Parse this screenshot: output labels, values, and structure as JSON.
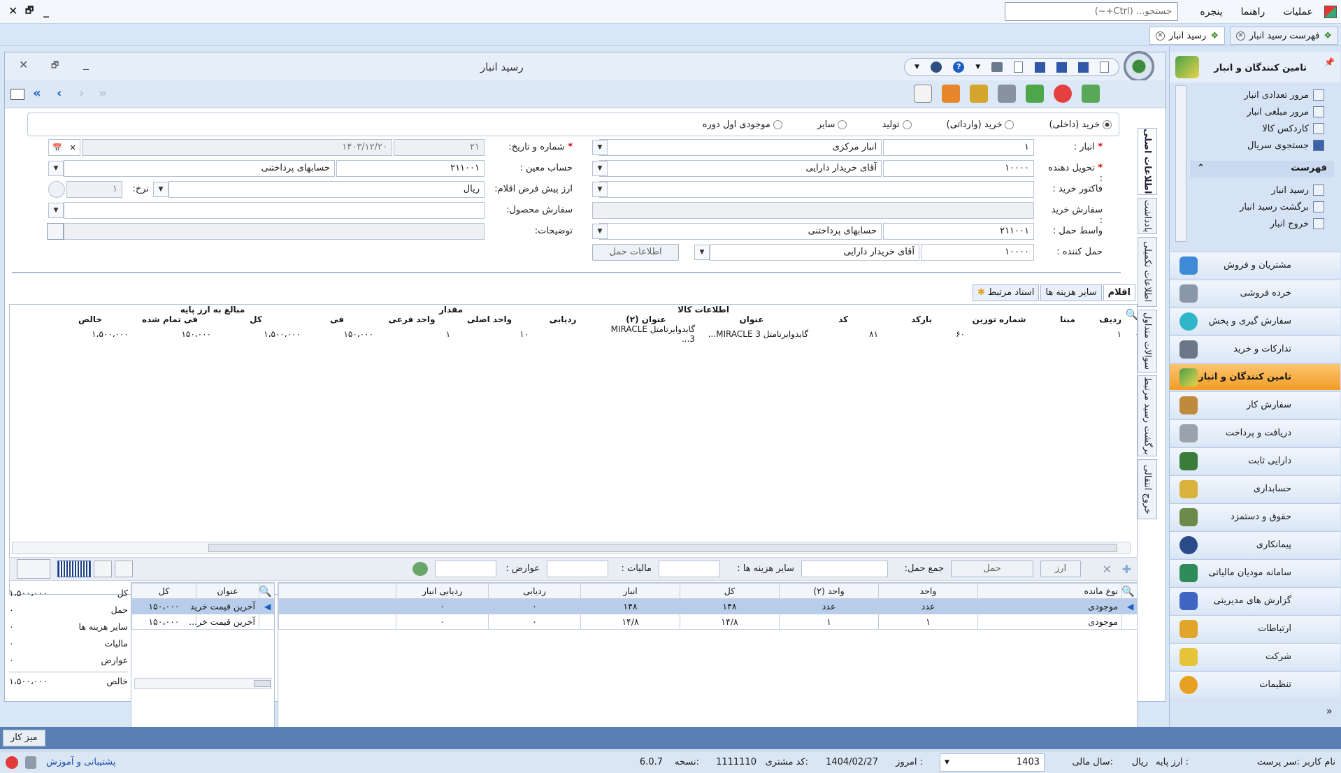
{
  "menu": {
    "items": [
      "عملیات",
      "راهنما",
      "پنجره"
    ],
    "search_placeholder": "جستجو... (Ctrl+~)"
  },
  "tabs": [
    {
      "label": "فهرست رسید انبار"
    },
    {
      "label": "رسید انبار"
    }
  ],
  "window": {
    "title": "رسید انبار"
  },
  "vtabs": [
    "اطلاعات اصلی",
    "یادداشت",
    "اطلاعات تکمیلی",
    "سوالات متداول",
    "برگشت رسید مرتبط",
    "خروج انتقالی"
  ],
  "form": {
    "radios": [
      "خرید (داخلی)",
      "خرید (وارداتی)",
      "تولید",
      "سایر",
      "موجودی اول دوره"
    ],
    "anbar_label": "انبار :",
    "anbar_code": "۱",
    "anbar_name": "انبار مرکزی",
    "tahvil_label": "تحویل دهنده :",
    "tahvil_code": "۱۰۰۰۰",
    "tahvil_name": "آقای خریدار دارایی",
    "factor_label": "فاکتور خرید :",
    "sefaresh_label": "سفارش خرید :",
    "vaset_label": "واسط حمل :",
    "vaset_code": "۲۱۱۰۰۱",
    "vaset_name": "حسابهای پرداختنی",
    "haml_label": "حمل کننده :",
    "haml_code": "۱۰۰۰۰",
    "haml_name": "آقای خریدار دارایی",
    "haml_btn": "اطلاعات حمل",
    "shomare_label": "شماره و تاریخ:",
    "shomare": "۲۱",
    "tarikh": "۱۴۰۳/۱۲/۲۰",
    "hesab_label": "حساب معین :",
    "hesab_code": "۲۱۱۰۰۱",
    "hesab_name": "حسابهای پرداختنی",
    "arz_label": "ارز پیش فرض اقلام:",
    "arz": "ریال",
    "nerkh_label": "نرخ:",
    "nerkh": "۱",
    "mahsool_label": "سفارش محصول:",
    "tozih_label": "توضیحات:"
  },
  "gridtabs": [
    "اقلام",
    "سایر هزینه ها",
    "اسناد مرتبط"
  ],
  "grid": {
    "groups": [
      "اطلاعات کالا",
      "مقدار",
      "مبالغ به ارز پایه"
    ],
    "headers": [
      "ردیف",
      "مبنا",
      "شماره توزین",
      "بارکد",
      "کد",
      "عنوان",
      "عنوان (۲)",
      "ردیابی",
      "واحد اصلی",
      "واحد فرعی",
      "فی",
      "کل",
      "فی تمام شده",
      "خالص"
    ],
    "rows": [
      [
        "۱",
        "",
        "",
        "۶۰",
        "۸۱",
        "گایدوایرتامتل MIRACLE 3...",
        "گایدوایرتامتل MIRACLE 3...",
        "",
        "۱۰",
        "۱",
        "۱۵۰،۰۰۰",
        "۱،۵۰۰،۰۰۰",
        "۱۵۰،۰۰۰",
        "۱،۵۰۰،۰۰۰"
      ]
    ]
  },
  "bar2": {
    "arz": "ارز",
    "haml": "حمل",
    "jam_haml": "جمع حمل:",
    "sayer": "سایر هزینه ها :",
    "maliat": "مالیات :",
    "avarez": "عوارض :"
  },
  "bottom_left": {
    "headers": [
      "نوع مانده",
      "واحد",
      "واحد (۲)",
      "کل",
      "انبار",
      "ردیابی",
      "ردیابی انبار"
    ],
    "rows": [
      [
        "موجودی",
        "عدد",
        "عدد",
        "۱۴۸",
        "۱۴۸",
        "۰",
        "۰"
      ],
      [
        "موجودی",
        "۱",
        "۱",
        "۱۴/۸",
        "۱۴/۸",
        "۰",
        "۰"
      ]
    ]
  },
  "bottom_mid": {
    "headers": [
      "عنوان",
      "کل"
    ],
    "rows": [
      [
        "آخرین قیمت خرید",
        "۱۵۰،۰۰۰"
      ],
      [
        "آخرین قیمت خر...",
        "۱۵۰،۰۰۰"
      ]
    ]
  },
  "summary": [
    [
      "کل",
      "۱،۵۰۰،۰۰۰"
    ],
    [
      "حمل",
      "۰"
    ],
    [
      "سایر هزینه ها",
      "۰"
    ],
    [
      "مالیات",
      "۰"
    ],
    [
      "عوارض",
      "۰"
    ],
    [
      "خالص",
      "۱،۵۰۰،۰۰۰"
    ]
  ],
  "sidebar": {
    "title": "تامین کنندگان و انبار",
    "subitems": [
      "مرور تعدادی انبار",
      "مرور مبلغی انبار",
      "کاردکس کالا",
      "جستجوی سریال"
    ],
    "cat": "فهرست",
    "catitems": [
      "رسید انبار",
      "برگشت رسید انبار",
      "خروج انبار"
    ],
    "modules": [
      "مشتریان و فروش",
      "خرده فروشی",
      "سفارش گیری و پخش",
      "تدارکات و خرید",
      "تامین کنندگان و انبار",
      "سفارش کار",
      "دریافت و پرداخت",
      "دارایی ثابت",
      "حسابداری",
      "حقوق و دستمزد",
      "پیمانکاری",
      "سامانه مودیان مالیاتی",
      "گزارش های مدیریتی",
      "ارتباطات",
      "شرکت",
      "تنظیمات"
    ]
  },
  "taskbar": {
    "label": "میز کار"
  },
  "status": {
    "user": "نام کاربر :سر پرست",
    "arz": "ارز پایه :",
    "arz_v": "ریال",
    "year": "سال مالی:",
    "year_v": "1403",
    "today": "امروز :",
    "today_v": "1404/02/27",
    "cust": "کد مشتری:",
    "cust_v": "1111110",
    "ver": "نسخه:",
    "ver_v": "6.0.7",
    "support": "پشتیبانی و آموزش"
  }
}
